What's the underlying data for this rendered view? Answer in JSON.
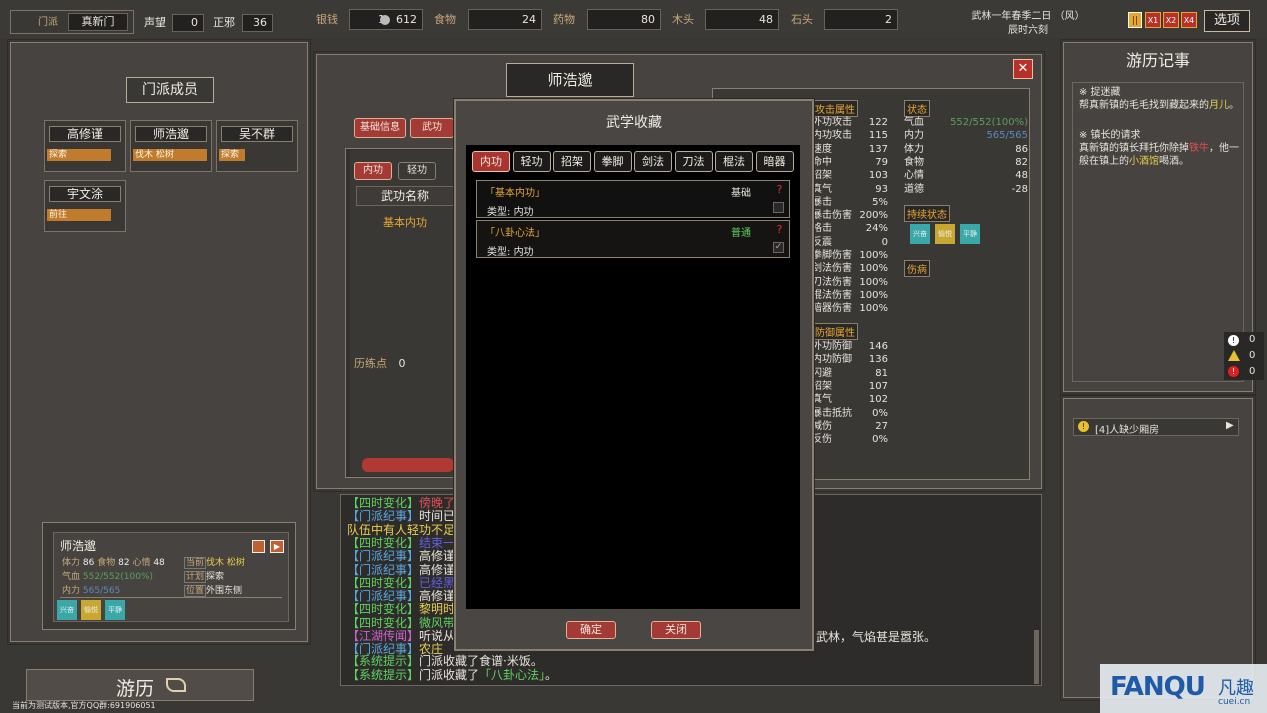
{
  "top": {
    "sect_label": "门派",
    "sect_name": "真新门",
    "prestige_label": "声望",
    "prestige_val": "0",
    "alignment_label": "正邪",
    "alignment_val": "36",
    "silver_label": "银钱",
    "silver_val": "1，612",
    "food_label": "食物",
    "food_val": "24",
    "medicine_label": "药物",
    "medicine_val": "80",
    "wood_label": "木头",
    "wood_val": "48",
    "stone_label": "石头",
    "stone_val": "2",
    "date_line1": "武林一年春季二日 （风）",
    "date_line2": "辰时六刻",
    "speed": [
      "||",
      "X1",
      "X2",
      "X4"
    ],
    "options_label": "选项"
  },
  "left": {
    "title": "门派成员",
    "members": [
      {
        "name": "高修谨",
        "tag": "探索"
      },
      {
        "name": "师浩邈",
        "tag": "伐木 松树"
      },
      {
        "name": "吴不群",
        "tag": "探索"
      },
      {
        "name": "宇文涂",
        "tag": "前往"
      }
    ],
    "card": {
      "name": "师浩邈",
      "stats_line": [
        "体力",
        "86",
        "食物",
        "82",
        "心情",
        "48"
      ],
      "hp_label": "气血",
      "hp_val": "552/552(100%)",
      "mp_label": "内力",
      "mp_val": "565/565",
      "task_lbl1": "当前",
      "task_val1": "伐木 松树",
      "task_lbl2": "计划",
      "task_val2": "探索",
      "task_lbl3": "位置",
      "task_val3": "外围东侧",
      "buffs": [
        "兴奋",
        "愉悦",
        "平静"
      ]
    },
    "travel_label": "游历",
    "version_text": "当前为测试版本,官方QQ群:691906051"
  },
  "center": {
    "char_name": "师浩邈",
    "tabs": [
      "基础信息",
      "武功"
    ],
    "subtabs": [
      "内功",
      "轻功"
    ],
    "col_header": "武功名称",
    "skill_name": "基本内功",
    "practice_label": "历练点",
    "practice_val": "0"
  },
  "stats": {
    "attack_header": "攻击属性",
    "attack_rows": [
      [
        "外功攻击",
        "122"
      ],
      [
        "内功攻击",
        "115"
      ],
      [
        "速度",
        "137"
      ],
      [
        "命中",
        "79"
      ],
      [
        "招架",
        "103"
      ],
      [
        "真气",
        "93"
      ],
      [
        "暴击",
        "5%"
      ],
      [
        "暴击伤害",
        "200%"
      ],
      [
        "格击",
        "24%"
      ],
      [
        "反震",
        "0"
      ],
      [
        "拳脚伤害",
        "100%"
      ],
      [
        "剑法伤害",
        "100%"
      ],
      [
        "刀法伤害",
        "100%"
      ],
      [
        "棍法伤害",
        "100%"
      ],
      [
        "暗器伤害",
        "100%"
      ]
    ],
    "defense_header": "防御属性",
    "defense_rows": [
      [
        "外功防御",
        "146"
      ],
      [
        "内功防御",
        "136"
      ],
      [
        "闪避",
        "81"
      ],
      [
        "招架",
        "107"
      ],
      [
        "真气",
        "102"
      ],
      [
        "暴击抵抗",
        "0%"
      ],
      [
        "减伤",
        "27"
      ],
      [
        "反伤",
        "0%"
      ]
    ],
    "status_header": "状态",
    "status_rows": [
      [
        "气血",
        "552/552(100%)"
      ],
      [
        "内力",
        "565/565"
      ],
      [
        "体力",
        "86"
      ],
      [
        "食物",
        "82"
      ],
      [
        "心情",
        "48"
      ],
      [
        "道德",
        "-28"
      ]
    ],
    "lasting_header": "持续状态",
    "buffs": [
      "兴奋",
      "愉悦",
      "平静"
    ],
    "injury_header": "伤病"
  },
  "modal": {
    "title": "武学收藏",
    "tabs": [
      "内功",
      "轻功",
      "招架",
      "拳脚",
      "剑法",
      "刀法",
      "棍法",
      "暗器"
    ],
    "skills": [
      {
        "name": "「基本内功」",
        "level": "基础",
        "type_label": "类型:",
        "type_val": "内功",
        "q": "?"
      },
      {
        "name": "「八卦心法」",
        "level": "普通",
        "type_label": "类型:",
        "type_val": "内功",
        "q": "?"
      }
    ],
    "ok_label": "确定",
    "close_label": "关闭"
  },
  "log": [
    {
      "tag": "【四时变化】",
      "text": "傍晚了",
      "tag_color": "#5fd35f",
      "text_color": "#e05050"
    },
    {
      "tag": "【门派纪事】",
      "text": "时间已",
      "tag_color": "#5aa8e0",
      "text_color": "#e8e4dc"
    },
    {
      "tag": "",
      "text": "队伍中有人轻功不足",
      "tag_color": "#e8d050",
      "text_color": "#e8d050"
    },
    {
      "tag": "【四时变化】",
      "text": "结束一",
      "tag_color": "#5fd35f",
      "text_color": "#6060e0"
    },
    {
      "tag": "【门派纪事】",
      "text": "高修谨",
      "tag_color": "#5aa8e0",
      "text_color": "#e8e4dc"
    },
    {
      "tag": "【门派纪事】",
      "text": "高修谨",
      "tag_color": "#5aa8e0",
      "text_color": "#e8e4dc"
    },
    {
      "tag": "【四时变化】",
      "text": "已经黑",
      "tag_color": "#5fd35f",
      "text_color": "#6060e0"
    },
    {
      "tag": "【门派纪事】",
      "text": "高修谨",
      "tag_color": "#5aa8e0",
      "text_color": "#e8e4dc"
    },
    {
      "tag": "【四时变化】",
      "text": "黎明时",
      "tag_color": "#5fd35f",
      "text_color": "#e8d050"
    },
    {
      "tag": "【四时变化】",
      "text": "微风带",
      "tag_color": "#5fd35f",
      "text_color": "#5fd35f"
    },
    {
      "tag": "【江湖传闻】",
      "text": "听说从",
      "tag_color": "#d060d0",
      "text_color": "#e8e4dc"
    },
    {
      "tag": "【门派纪事】",
      "text": "农庄",
      "tag_color": "#5aa8e0",
      "text_color": "#e8d050"
    }
  ],
  "log_tail": "武林，气焰甚是嚣张。",
  "log_sys": [
    {
      "tag": "【系统提示】",
      "text": "门派收藏了食谱·米饭。"
    },
    {
      "tag": "【系统提示】",
      "text": "门派收藏了",
      "hl": "「八卦心法」",
      "end": "。"
    }
  ],
  "right": {
    "title": "游历记事",
    "quests": [
      {
        "head": "※ 捉迷藏",
        "body": "帮真新镇的毛毛找到藏起来的",
        "hl": "月儿",
        "tail": "。"
      },
      {
        "head": "※ 镇长的请求",
        "body": "真新镇的镇长拜托你除掉",
        "hl": "铁牛",
        "mid": "，他一般在镇上的",
        "hl2": "小酒馆",
        "tail": "喝酒。"
      }
    ],
    "alerts": [
      "0",
      "0",
      "0"
    ],
    "event": "[4]人缺少厢房"
  },
  "watermark": {
    "brand": "FANQU",
    "cn": "凡趣",
    "site": "cuei.cn"
  }
}
